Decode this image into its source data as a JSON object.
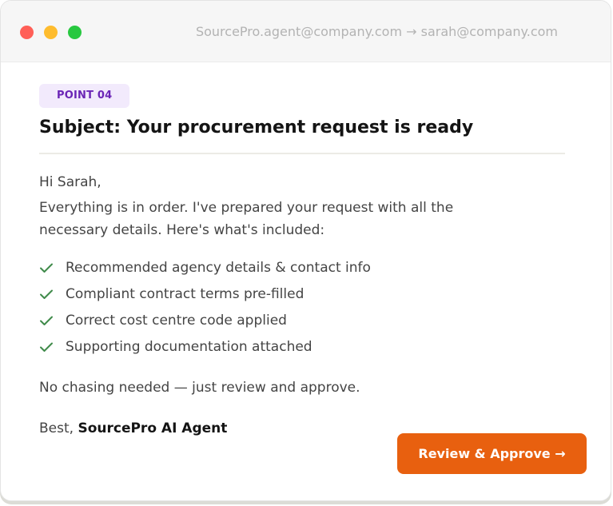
{
  "window": {
    "controls": [
      {
        "name": "close",
        "color": "#ff5f57"
      },
      {
        "name": "minimize",
        "color": "#febc2e"
      },
      {
        "name": "maximize",
        "color": "#28c840"
      }
    ],
    "address": "SourcePro.agent@company.com → sarah@company.com"
  },
  "email": {
    "badge": "POINT 04",
    "subject": "Subject: Your procurement request is ready",
    "greeting": "Hi Sarah,",
    "intro": "Everything is in order. I've prepared your request with all the necessary details. Here's what's included:",
    "checklist": [
      {
        "icon": "checkmark-icon",
        "label": "Recommended agency details & contact info"
      },
      {
        "icon": "checkmark-icon",
        "label": "Compliant contract terms pre-filled"
      },
      {
        "icon": "checkmark-icon",
        "label": "Correct cost centre code applied"
      },
      {
        "icon": "checkmark-icon",
        "label": "Supporting documentation attached"
      }
    ],
    "closing": "No chasing needed — just review and approve.",
    "signoff_prefix": "Best, ",
    "signoff_name": "SourcePro AI Agent",
    "cta_label": "Review & Approve →"
  },
  "colors": {
    "accent": "#e8600f",
    "badge_bg": "#f2eafc",
    "badge_text": "#6b25b6",
    "check": "#3f8a4a"
  }
}
